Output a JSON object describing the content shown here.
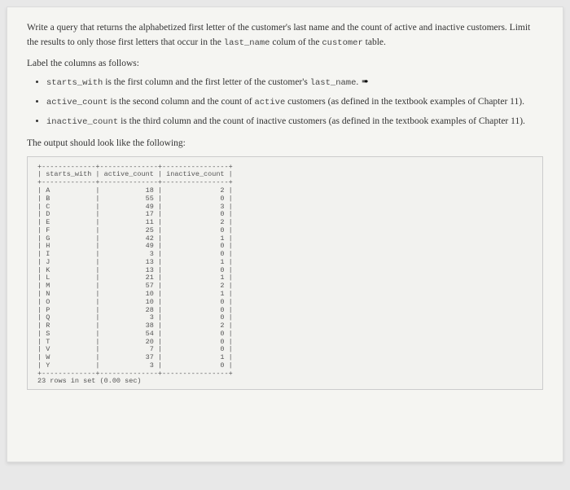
{
  "intro": {
    "line1_pre": "Write a query that returns the alphabetized first letter of the customer's last name and the count of active and inactive customers. Limit the results to only those first letters that occur in the ",
    "code1": "last_name",
    "mid1": " colum of the ",
    "code2": "customer",
    "post1": " table."
  },
  "label_heading": "Label the columns as follows:",
  "bullets": [
    {
      "code": "starts_with",
      "rest": " is the first column and the first letter of the customer's ",
      "code2": "last_name",
      "tail": "."
    },
    {
      "code": "active_count",
      "rest": " is the second column and the count of ",
      "code2": "active",
      "tail": " customers (as defined in the textbook examples of Chapter 11)."
    },
    {
      "code": "inactive_count",
      "rest": " is the third column and the count of inactive customers (as defined in the textbook examples of Chapter 11).",
      "code2": "",
      "tail": ""
    }
  ],
  "output_label": "The output should look like the following:",
  "table": {
    "headers": [
      "starts_with",
      "active_count",
      "inactive_count"
    ],
    "rows": [
      {
        "l": "A",
        "a": 18,
        "i": 2
      },
      {
        "l": "B",
        "a": 55,
        "i": 0
      },
      {
        "l": "C",
        "a": 49,
        "i": 3
      },
      {
        "l": "D",
        "a": 17,
        "i": 0
      },
      {
        "l": "E",
        "a": 11,
        "i": 2
      },
      {
        "l": "F",
        "a": 25,
        "i": 0
      },
      {
        "l": "G",
        "a": 42,
        "i": 1
      },
      {
        "l": "H",
        "a": 49,
        "i": 0
      },
      {
        "l": "I",
        "a": 3,
        "i": 0
      },
      {
        "l": "J",
        "a": 13,
        "i": 1
      },
      {
        "l": "K",
        "a": 13,
        "i": 0
      },
      {
        "l": "L",
        "a": 21,
        "i": 1
      },
      {
        "l": "M",
        "a": 57,
        "i": 2
      },
      {
        "l": "N",
        "a": 10,
        "i": 1
      },
      {
        "l": "O",
        "a": 10,
        "i": 0
      },
      {
        "l": "P",
        "a": 28,
        "i": 0
      },
      {
        "l": "Q",
        "a": 3,
        "i": 0
      },
      {
        "l": "R",
        "a": 38,
        "i": 2
      },
      {
        "l": "S",
        "a": 54,
        "i": 0
      },
      {
        "l": "T",
        "a": 20,
        "i": 0
      },
      {
        "l": "V",
        "a": 7,
        "i": 0
      },
      {
        "l": "W",
        "a": 37,
        "i": 1
      },
      {
        "l": "Y",
        "a": 3,
        "i": 0
      }
    ],
    "footer": "23 rows in set (0.00 sec)"
  }
}
